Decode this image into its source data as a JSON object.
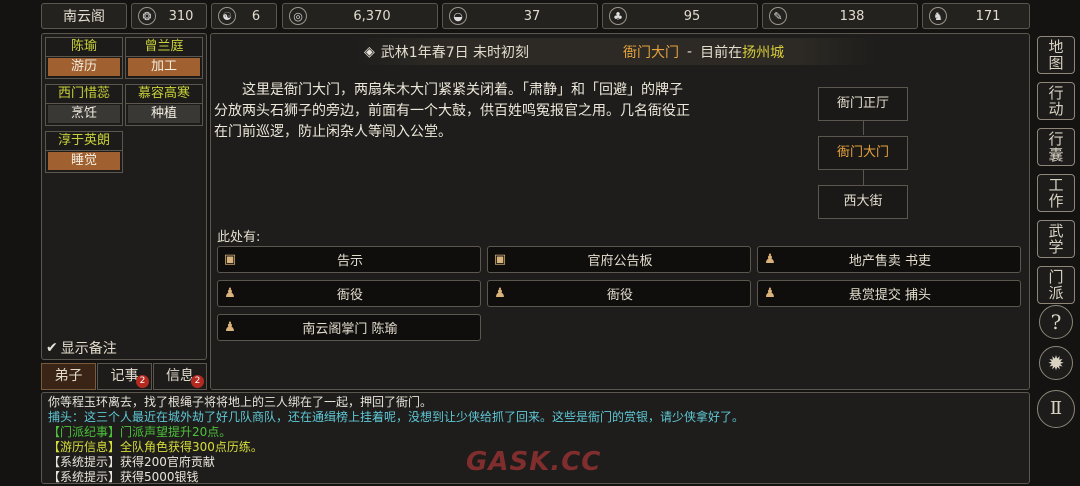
{
  "topbar": {
    "sect_name": "南云阁",
    "stats": [
      {
        "icon": "coin-pouch-icon",
        "glyph": "❂",
        "value": "310"
      },
      {
        "icon": "yin-yang-icon",
        "glyph": "☯",
        "value": "6"
      },
      {
        "icon": "money-icon",
        "glyph": "◎",
        "value": "6,370"
      },
      {
        "icon": "food-bowl-icon",
        "glyph": "◒",
        "value": "37"
      },
      {
        "icon": "herb-icon",
        "glyph": "♣",
        "value": "95"
      },
      {
        "icon": "scroll-icon",
        "glyph": "✎",
        "value": "138"
      },
      {
        "icon": "beast-icon",
        "glyph": "♞",
        "value": "171"
      }
    ]
  },
  "disciples": [
    {
      "name": "陈瑜",
      "activity": "游历",
      "style": "orange"
    },
    {
      "name": "曾兰庭",
      "activity": "加工",
      "style": "orange"
    },
    {
      "name": "西门惜蕊",
      "activity": "烹饪",
      "style": "gray"
    },
    {
      "name": "慕容高寒",
      "activity": "种植",
      "style": "gray"
    },
    {
      "name": "淳于英朗",
      "activity": "睡觉",
      "style": "orange"
    }
  ],
  "show_notes": {
    "check": "✔",
    "label": "显示备注"
  },
  "tabs": [
    {
      "label": "弟子",
      "badge": ""
    },
    {
      "label": "记事",
      "badge": "2"
    },
    {
      "label": "信息",
      "badge": "2"
    }
  ],
  "location_bar": {
    "icon_glyph": "◈",
    "date": "武林1年春7日 未时初刻",
    "place": "衙门大门",
    "separator": "-",
    "current_prefix": "目前在",
    "city": "扬州城"
  },
  "description": "这里是衙门大门，两扇朱木大门紧紧关闭着。「肃静」和「回避」的牌子分放两头石狮子的旁边，前面有一个大鼓，供百姓鸣冤报官之用。几名衙役正在门前巡逻，防止闲杂人等闯入公堂。",
  "map_nodes": [
    "衙门正厅",
    "衙门大门",
    "西大街"
  ],
  "here_label": "此处有:",
  "entities": [
    {
      "label": "告示",
      "kind": "item",
      "glyph": "▣"
    },
    {
      "label": "官府公告板",
      "kind": "item",
      "glyph": "▣"
    },
    {
      "label": "地产售卖 书吏",
      "kind": "npc",
      "glyph": "♟"
    },
    {
      "label": "衙役",
      "kind": "npc",
      "glyph": "♟"
    },
    {
      "label": "衙役",
      "kind": "npc",
      "glyph": "♟"
    },
    {
      "label": "悬赏提交 捕头",
      "kind": "npc",
      "glyph": "♟"
    },
    {
      "label": "南云阁掌门 陈瑜",
      "kind": "npc",
      "glyph": "♟"
    }
  ],
  "log": [
    {
      "text": "你等程玉环离去，找了根绳子将将地上的三人绑在了一起，押回了衙门。",
      "color": "#e8e4da"
    },
    {
      "text": "捕头：这三个人最近在城外劫了好几队商队，还在通缉榜上挂着呢，没想到让少侠给抓了回来。这些是衙门的赏银，请少侠拿好了。",
      "color": "#5ec8d6"
    },
    {
      "text": "【门派纪事】门派声望提升20点。",
      "color": "#4cc23b"
    },
    {
      "text": "【游历信息】全队角色获得300点历练。",
      "color": "#d6de3a"
    },
    {
      "text": "【系统提示】获得200官府贡献",
      "color": "#e8e4da"
    },
    {
      "text": "【系统提示】获得5000银钱",
      "color": "#e8e4da"
    }
  ],
  "watermark": "GASK.CC",
  "right_menu": [
    {
      "label": "地图",
      "name": "map-button"
    },
    {
      "label": "行动",
      "name": "action-button"
    },
    {
      "label": "行囊",
      "name": "bag-button"
    },
    {
      "label": "工作",
      "name": "work-button"
    },
    {
      "label": "武学",
      "name": "martial-button"
    },
    {
      "label": "门派",
      "name": "sect-button"
    }
  ],
  "right_icons": [
    {
      "glyph": "?",
      "name": "help-icon"
    },
    {
      "glyph": "✹",
      "name": "settings-gear-icon"
    },
    {
      "glyph": "Ⅱ",
      "name": "pause-icon"
    }
  ],
  "colors": {
    "accent_orange": "#e6a23c",
    "highlight_yellow": "#d8cc3a",
    "activity_orange": "#a0602f"
  }
}
